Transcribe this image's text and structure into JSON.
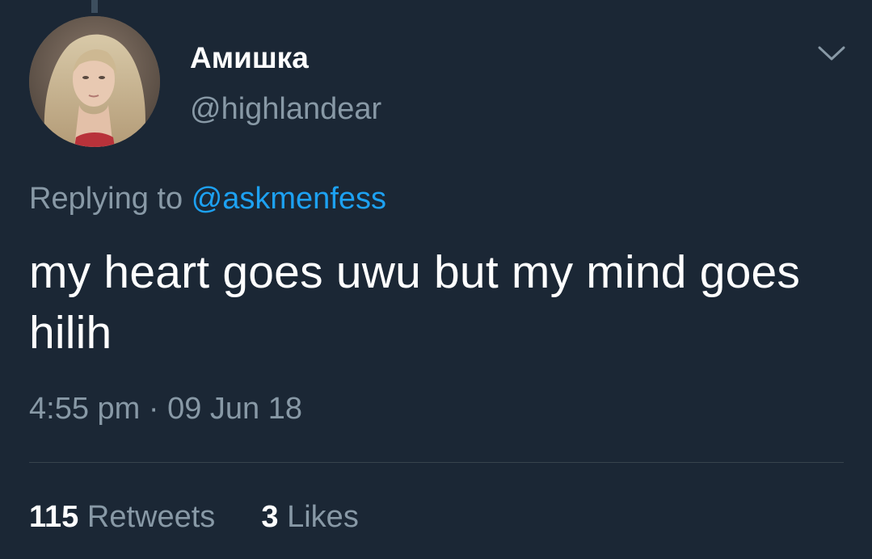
{
  "user": {
    "display_name": "Амишка",
    "handle": "@highlandear"
  },
  "reply": {
    "prefix": "Replying to",
    "mention": "@askmenfess"
  },
  "tweet": {
    "text": "my heart goes uwu but my mind goes hilih",
    "timestamp": "4:55 pm · 09 Jun 18"
  },
  "stats": {
    "retweets_count": "115",
    "retweets_label": "Retweets",
    "likes_count": "3",
    "likes_label": "Likes"
  },
  "colors": {
    "background": "#1b2735",
    "text_primary": "#ffffff",
    "text_secondary": "#8899a6",
    "link": "#1da1f2",
    "divider": "#38444d"
  },
  "icons": {
    "menu": "chevron-down-icon"
  }
}
